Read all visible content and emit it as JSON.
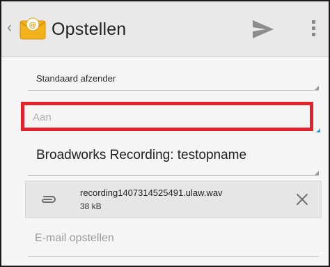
{
  "actionbar": {
    "title": "Opstellen",
    "back_icon": "chevron-left-icon",
    "app_icon": "email-envelope-icon",
    "send_icon": "send-icon",
    "overflow_icon": "overflow-menu-icon"
  },
  "compose": {
    "sender": "Standaard afzender",
    "to_placeholder": "Aan",
    "to_value": "",
    "subject": "Broadworks Recording: testopname",
    "body_placeholder": "E-mail opstellen"
  },
  "attachment": {
    "icon": "paperclip-icon",
    "filename": "recording1407314525491.ulaw.wav",
    "size": "38 kB",
    "remove_icon": "close-icon"
  },
  "colors": {
    "highlight": "#e2232b",
    "actionbar": "#e9e9e9",
    "background": "#f5f5f5",
    "accent": "#2aa3d8"
  }
}
